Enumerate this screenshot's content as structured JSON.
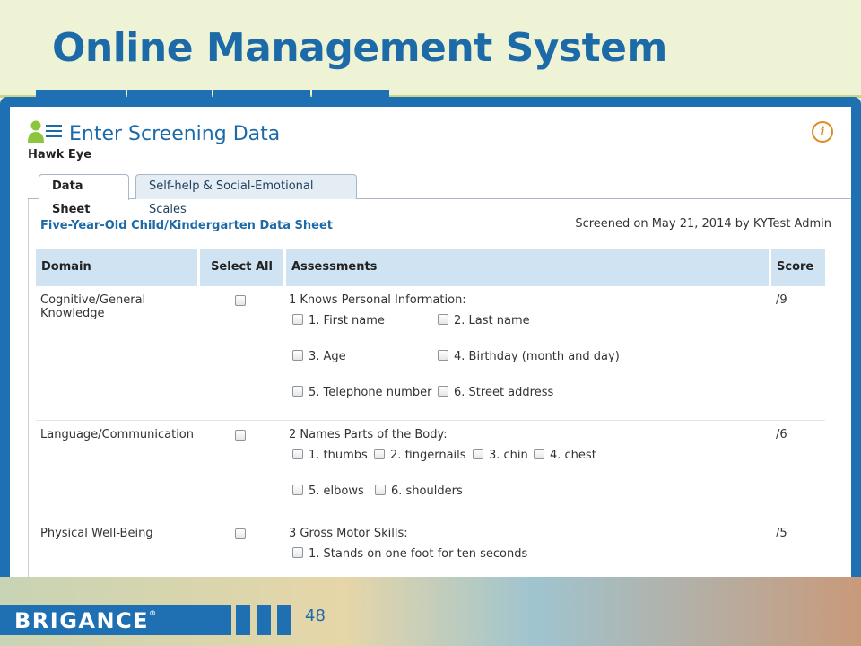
{
  "slide": {
    "title": "Online Management System",
    "page_number": "48"
  },
  "brand": {
    "logo_text": "BRIGANCE",
    "logo_mark": "®",
    "primary_color": "#1f6fb3",
    "title_color": "#1d6aa8",
    "header_fill": "#cfe3f2",
    "info_color": "#e08a1e"
  },
  "panel": {
    "title": "Enter Screening Data",
    "subtitle": "Hawk Eye",
    "info_icon": "i",
    "icons": {
      "header": "person-list-icon",
      "info": "info-icon"
    }
  },
  "tabs": [
    {
      "label": "Data Sheet",
      "active": true
    },
    {
      "label": "Self-help & Social-Emotional Scales",
      "active": false
    }
  ],
  "sheet": {
    "title": "Five-Year-Old Child/Kindergarten Data Sheet",
    "screened_on": "Screened on May 21, 2014 by KYTest Admin"
  },
  "table": {
    "headers": {
      "domain": "Domain",
      "select_all": "Select All",
      "assessments": "Assessments",
      "score": "Score"
    },
    "rows": [
      {
        "domain": "Cognitive/General Knowledge",
        "assessment": "1 Knows Personal Information:",
        "score": "/9",
        "items": [
          "1. First name",
          "2. Last name",
          "3. Age",
          "4. Birthday (month and day)",
          "5. Telephone number",
          "6. Street address"
        ]
      },
      {
        "domain": "Language/Communication",
        "assessment": "2 Names Parts of the Body:",
        "score": "/6",
        "items": [
          "1. thumbs",
          "2. fingernails",
          "3. chin",
          "4. chest",
          "5. elbows",
          "6. shoulders"
        ]
      },
      {
        "domain": "Physical Well-Being",
        "assessment": "3 Gross Motor Skills:",
        "score": "/5",
        "items": [
          "1. Stands on one foot for ten seconds"
        ]
      }
    ]
  }
}
